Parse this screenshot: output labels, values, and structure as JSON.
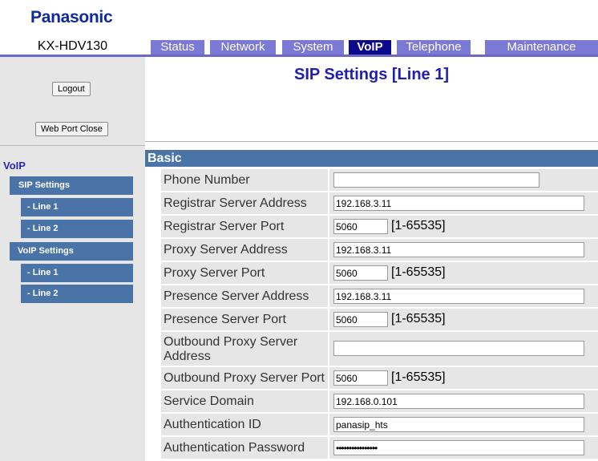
{
  "brand": "Panasonic",
  "model": "KX-HDV130",
  "tabs": [
    {
      "label": "Status"
    },
    {
      "label": "Network"
    },
    {
      "label": "System"
    },
    {
      "label": "VoIP"
    },
    {
      "label": "Telephone"
    },
    {
      "label": "Maintenance"
    }
  ],
  "sidebar": {
    "logout": "Logout",
    "web_port_close": "Web Port Close",
    "title": "VoIP",
    "menu": [
      {
        "label": "SIP Settings"
      },
      {
        "label": "- Line 1"
      },
      {
        "label": "- Line 2"
      },
      {
        "label": "VoIP Settings"
      },
      {
        "label": "- Line 1"
      },
      {
        "label": "- Line 2"
      }
    ]
  },
  "page": {
    "title": "SIP Settings [Line 1]",
    "section": "Basic"
  },
  "fields": [
    {
      "label": "Phone Number",
      "value": ""
    },
    {
      "label": "Registrar Server Address",
      "value": "192.168.3.11"
    },
    {
      "label": "Registrar Server Port",
      "value": "5060",
      "range": "[1-65535]"
    },
    {
      "label": "Proxy Server Address",
      "value": "192.168.3.11"
    },
    {
      "label": "Proxy Server Port",
      "value": "5060",
      "range": "[1-65535]"
    },
    {
      "label": "Presence Server Address",
      "value": "192.168.3.11"
    },
    {
      "label": "Presence Server Port",
      "value": "5060",
      "range": "[1-65535]"
    },
    {
      "label": "Outbound Proxy Server Address",
      "value": ""
    },
    {
      "label": "Outbound Proxy Server Port",
      "value": "5060",
      "range": "[1-65535]"
    },
    {
      "label": "Service Domain",
      "value": "192.168.0.101"
    },
    {
      "label": "Authentication ID",
      "value": "panasip_hts"
    },
    {
      "label": "Authentication Password",
      "value": "••••••••••••••••"
    }
  ]
}
